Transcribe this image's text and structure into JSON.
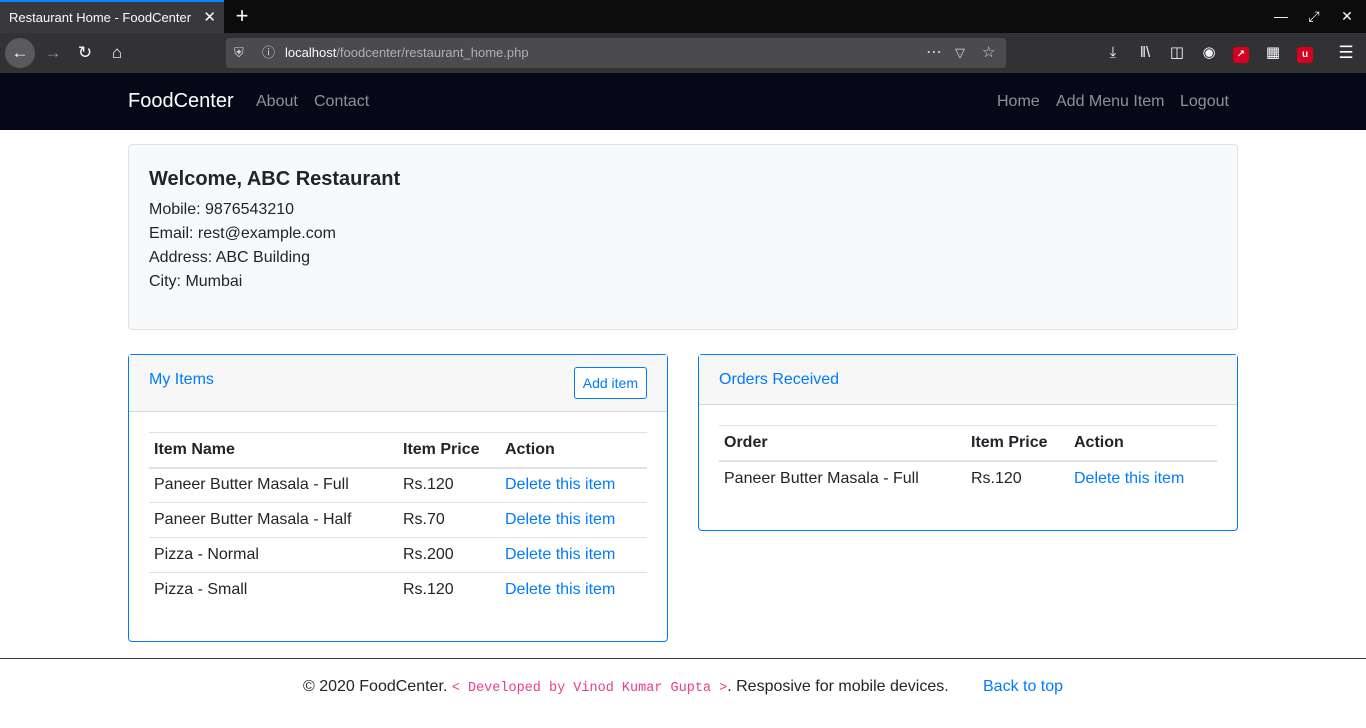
{
  "browser": {
    "tab_title": "Restaurant Home - FoodCenter",
    "tab_close": "✕",
    "new_tab": "+",
    "url_host": "localhost",
    "url_path": "/foodcenter/restaurant_home.php",
    "icons": [
      "back-arrow-icon",
      "forward-arrow-icon",
      "reload-icon",
      "home-icon",
      "shield-icon",
      "info-icon",
      "page-actions-icon",
      "pocket-icon",
      "bookmark-star-icon",
      "download-icon",
      "library-icon",
      "sidebar-icon",
      "account-icon",
      "extension-red-icon",
      "extension-grid-icon",
      "extension-ublock-icon",
      "menu-icon"
    ]
  },
  "site_nav": {
    "brand": "FoodCenter",
    "left_links": [
      "About",
      "Contact"
    ],
    "right_links": [
      "Home",
      "Add Menu Item",
      "Logout"
    ]
  },
  "welcome": {
    "heading": "Welcome, ABC Restaurant",
    "mobile": "Mobile: 9876543210",
    "email": "Email: rest@example.com",
    "address": "Address: ABC Building",
    "city": "City: Mumbai"
  },
  "my_items": {
    "title": "My Items",
    "add_button": "Add item",
    "columns": [
      "Item Name",
      "Item Price",
      "Action"
    ],
    "rows": [
      {
        "name": "Paneer Butter Masala - Full",
        "price": "Rs.120",
        "action": "Delete this item"
      },
      {
        "name": "Paneer Butter Masala - Half",
        "price": "Rs.70",
        "action": "Delete this item"
      },
      {
        "name": "Pizza - Normal",
        "price": "Rs.200",
        "action": "Delete this item"
      },
      {
        "name": "Pizza - Small",
        "price": "Rs.120",
        "action": "Delete this item"
      }
    ]
  },
  "orders": {
    "title": "Orders Received",
    "columns": [
      "Order",
      "Item Price",
      "Action"
    ],
    "rows": [
      {
        "name": "Paneer Butter Masala - Full",
        "price": "Rs.120",
        "action": "Delete this item"
      }
    ]
  },
  "footer": {
    "copyright": "© 2020 FoodCenter. ",
    "developer": "< Developed by Vinod Kumar Gupta >",
    "tagline": ". Resposive for mobile devices.",
    "back_to_top": "Back to top"
  },
  "colors": {
    "accent": "#007bff",
    "navbar_bg": "#060818",
    "code_pink": "#e83e8c"
  }
}
